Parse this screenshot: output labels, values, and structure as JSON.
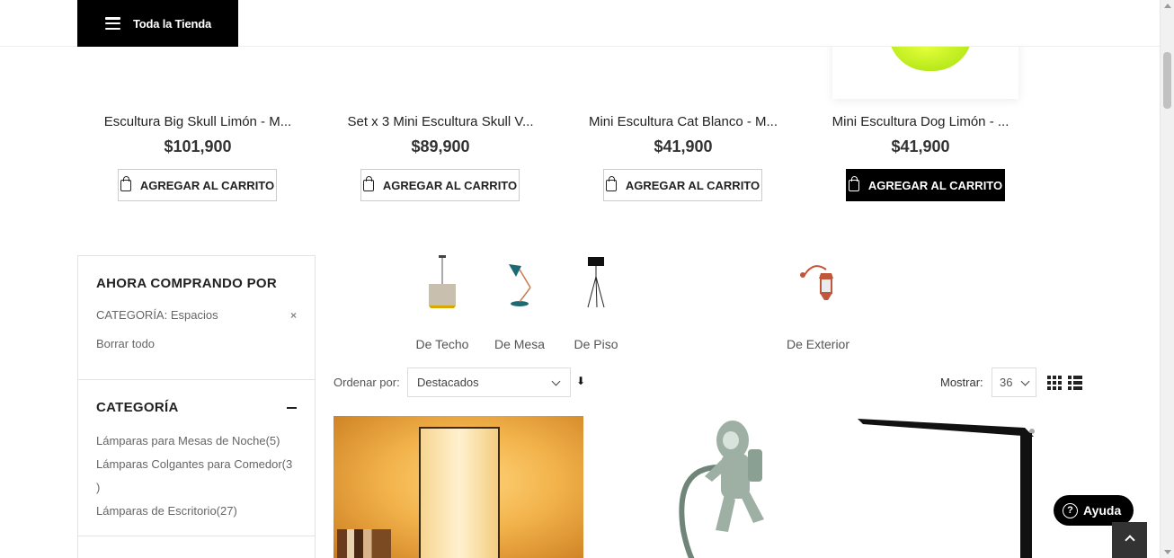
{
  "header": {
    "menu_label": "Toda la Tienda"
  },
  "products_top": [
    {
      "name": "Escultura Big Skull Limón - M...",
      "price": "$101,900",
      "button": "AGREGAR AL CARRITO"
    },
    {
      "name": "Set x 3 Mini Escultura Skull V...",
      "price": "$89,900",
      "button": "AGREGAR AL CARRITO"
    },
    {
      "name": "Mini Escultura Cat Blanco - M...",
      "price": "$41,900",
      "button": "AGREGAR AL CARRITO"
    },
    {
      "name": "Mini Escultura Dog Limón - ...",
      "price": "$41,900",
      "button": "AGREGAR AL CARRITO"
    }
  ],
  "sidebar": {
    "now_shopping": {
      "title": "AHORA COMPRANDO POR",
      "filter_label": "CATEGORÍA: Espacios",
      "remove_icon": "×",
      "clear_all": "Borrar todo"
    },
    "category": {
      "title": "CATEGORÍA",
      "items": [
        "Lámparas para Mesas de Noche(5)",
        "Lámparas Colgantes para Comedor(3",
        ")",
        "Lámparas de Escritorio(27)"
      ]
    }
  },
  "subcategories": [
    {
      "label": "De Techo",
      "icon": "pendant-lamp-icon"
    },
    {
      "label": "De Mesa",
      "icon": "desk-lamp-icon"
    },
    {
      "label": "De Piso",
      "icon": "floor-lamp-icon"
    },
    {
      "label": "De Exterior",
      "icon": "wall-lantern-icon"
    }
  ],
  "toolbar": {
    "sort_label": "Ordenar por:",
    "sort_value": "Destacados",
    "sort_dir_icon": "⬇",
    "show_label": "Mostrar:",
    "show_value": "36"
  },
  "help": {
    "label": "Ayuda",
    "icon": "?"
  },
  "colors": {
    "accent": "#000000",
    "lime": "#c6f22a"
  }
}
